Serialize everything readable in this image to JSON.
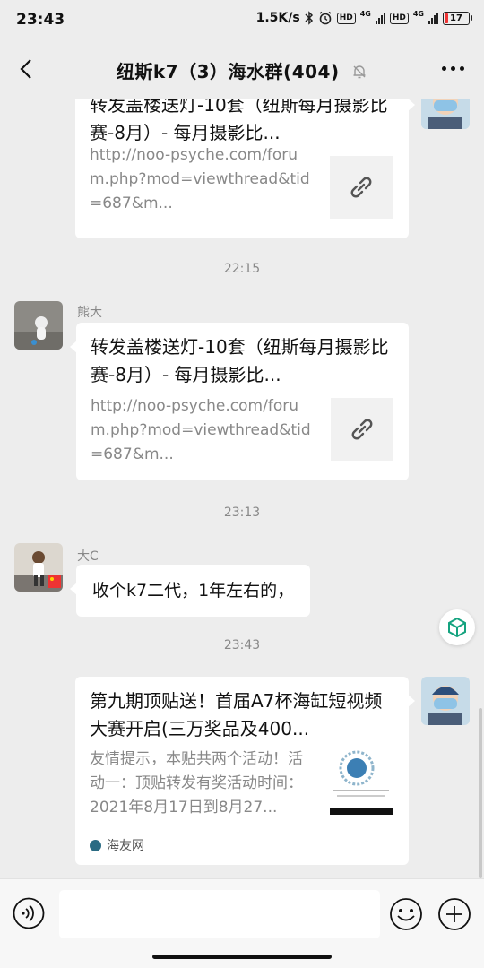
{
  "status_bar": {
    "time": "23:43",
    "network_speed": "1.5K/s",
    "hd1": "HD",
    "net1": "4G",
    "hd2": "HD",
    "net2": "4G",
    "battery": "17",
    "icons": [
      "bluetooth-icon",
      "alarm-icon",
      "signal-icon",
      "battery-icon"
    ]
  },
  "header": {
    "title": "纽斯k7（3）海水群(404)",
    "icons": [
      "back-icon",
      "mute-bell-icon",
      "more-icon"
    ]
  },
  "messages": {
    "m1": {
      "title": "转发盖楼送灯-10套（纽斯每月摄影比赛-8月）- 每月摄影比...",
      "url": "http://noo-psyche.com/forum.php?mod=viewthread&tid=687&m..."
    },
    "t1": "22:15",
    "m2": {
      "sender": "熊大",
      "title": "转发盖楼送灯-10套（纽斯每月摄影比赛-8月）- 每月摄影比...",
      "url": "http://noo-psyche.com/forum.php?mod=viewthread&tid=687&m..."
    },
    "t2": "23:13",
    "m3": {
      "sender": "大C",
      "text": "收个k7二代，1年左右的，"
    },
    "t3": "23:43",
    "m4": {
      "title": "第九期顶贴送！首届A7杯海缸短视频大赛开启(三万奖品及400...",
      "desc": "友情提示，本贴共两个活动！活动一：顶贴转发有奖活动时间：2021年8月17日到8月27...",
      "source": "海友网"
    }
  },
  "input_bar": {
    "input_value": "",
    "icons": [
      "voice-icon",
      "emoji-icon",
      "plus-icon"
    ]
  },
  "colors": {
    "background": "#ededed",
    "bubble": "#ffffff",
    "timestamp": "#888888",
    "battery_low": "#e33333"
  }
}
